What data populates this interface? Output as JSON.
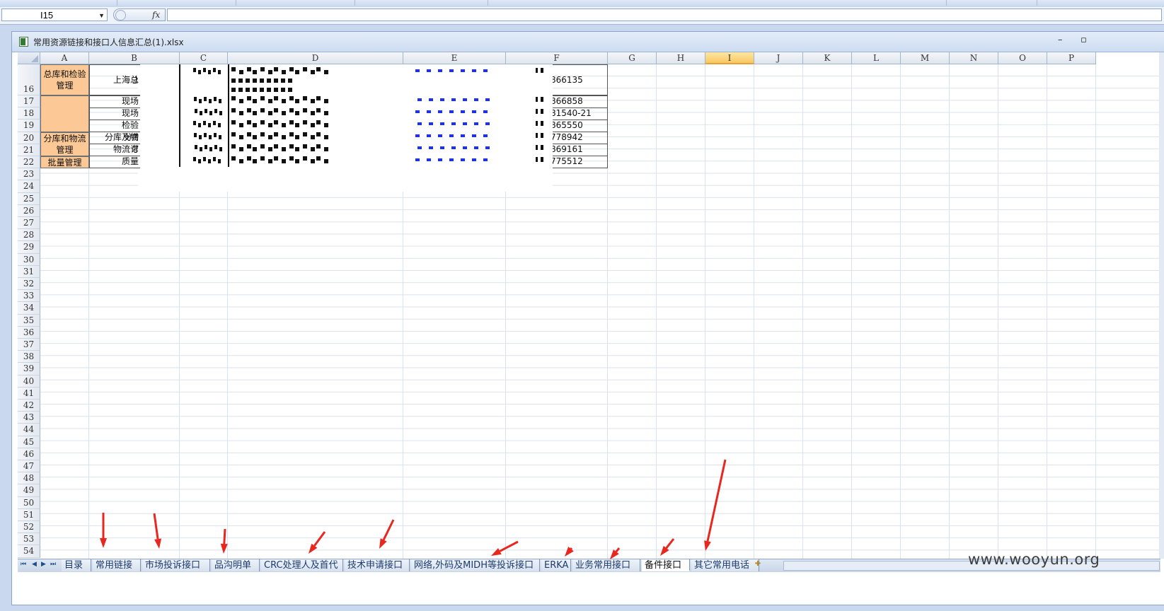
{
  "formula_bar": {
    "name_box": "I15",
    "fx_label": "fx",
    "formula": ""
  },
  "window": {
    "title": "常用资源链接和接口人信息汇总(1).xlsx",
    "minimize": "–",
    "restore": "▫"
  },
  "columns": [
    "A",
    "B",
    "C",
    "D",
    "E",
    "F",
    "G",
    "H",
    "I",
    "J",
    "K",
    "L",
    "M",
    "N",
    "O",
    "P"
  ],
  "selected_column": "I",
  "rows": [
    "16",
    "17",
    "18",
    "19",
    "20",
    "21",
    "22",
    "23",
    "24",
    "25",
    "26",
    "27",
    "28",
    "29",
    "30",
    "31",
    "32",
    "33",
    "34",
    "35",
    "36",
    "37",
    "38",
    "39",
    "40",
    "41",
    "42",
    "43",
    "44",
    "45",
    "46",
    "47",
    "48",
    "49",
    "50",
    "51",
    "52",
    "53",
    "54"
  ],
  "cells": {
    "a_16": "总库和检验管理",
    "a_20": "分库和物流管理",
    "a_22": "批量管理",
    "b_16": "上海总",
    "b_17": "现场",
    "b_18": "现场",
    "b_19": "检验",
    "b_20": "分库及物",
    "b_21": "物流订",
    "b_22": "质量",
    "f_16": "866135",
    "f_17": "866858",
    "f_18": "81540-21",
    "f_19": "865550",
    "f_20": "778942",
    "f_21": "869161",
    "f_22": "775512"
  },
  "sheet_tabs": [
    "目录",
    "常用链接",
    "市场投诉接口",
    "品沟明单",
    "CRC处理人及首代",
    "技术申请接口",
    "网络,外码及MIDH等投诉接口",
    "ERKA",
    "业务常用接口",
    "备件接口",
    "其它常用电话"
  ],
  "active_tab": "备件接口",
  "watermark": "www.wooyun.org",
  "colors": {
    "category_fill": "#fbc896",
    "selected_header": "#f8c861",
    "annotation_arrow": "#e8281e",
    "link_blue": "#1d2ff0"
  }
}
